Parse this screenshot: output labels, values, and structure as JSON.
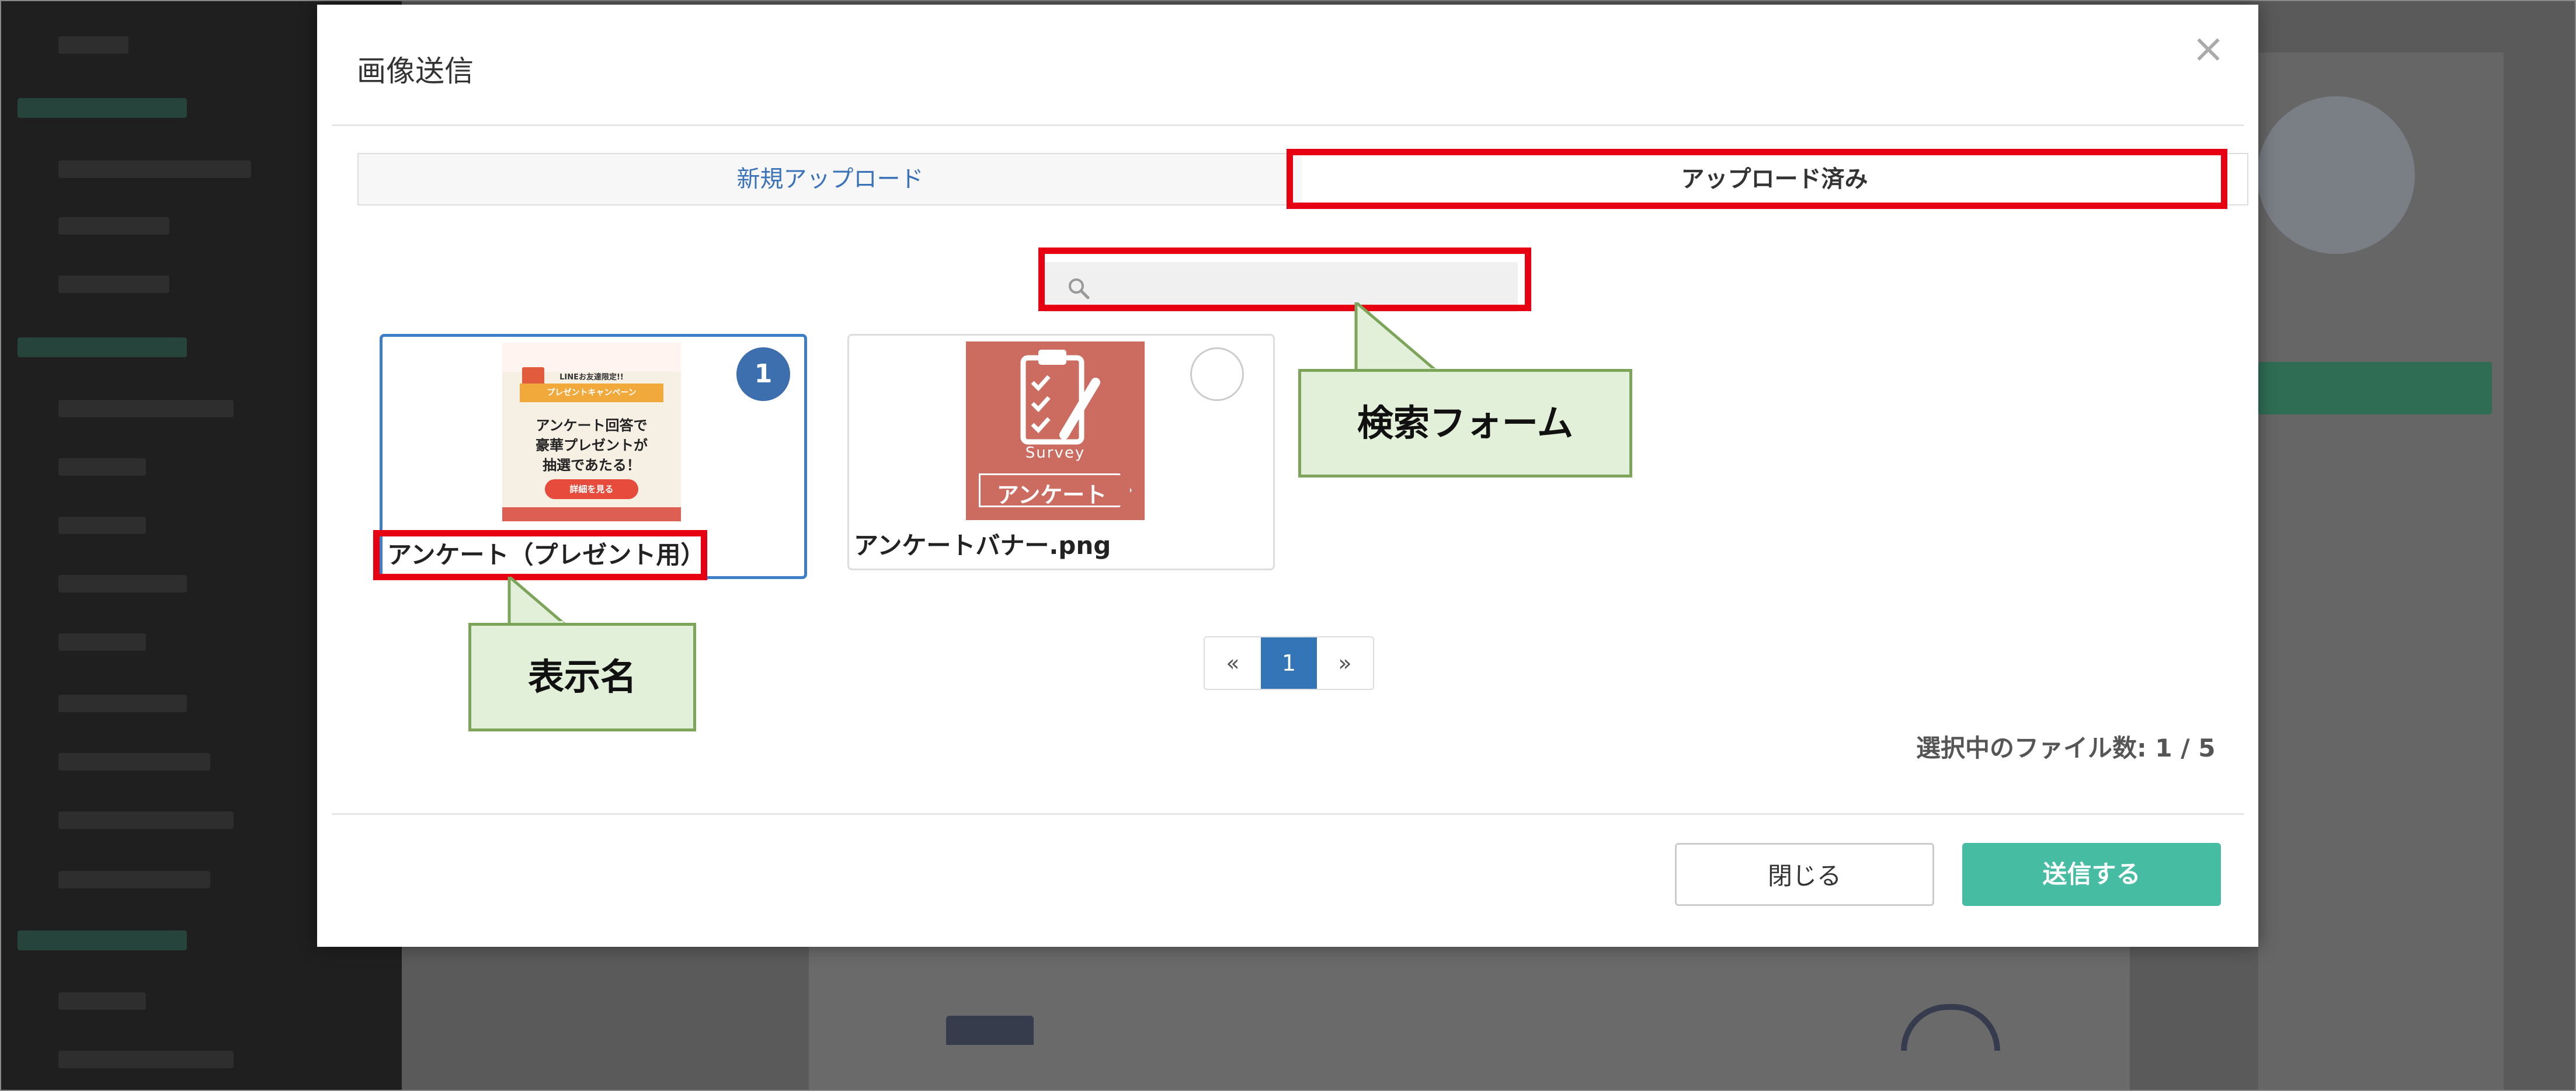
{
  "modal": {
    "title": "画像送信",
    "close_glyph": "×",
    "tabs": [
      {
        "label": "新規アップロード",
        "active": false
      },
      {
        "label": "アップロード済み",
        "active": true
      }
    ],
    "search": {
      "placeholder": "",
      "icon": "search-icon"
    },
    "images": [
      {
        "name": "アンケート（プレゼント用）",
        "selected": true,
        "order": "1",
        "thumb_text": {
          "top": "LINEお友達限定!!",
          "ribbon": "プレゼントキャンペーン",
          "line1": "アンケート回答で",
          "line2": "豪華プレゼントが",
          "line3": "抽選であたる！",
          "button": "詳細を見る"
        }
      },
      {
        "name": "アンケートバナー.png",
        "selected": false,
        "thumb_text": {
          "survey": "Survey",
          "label": "アンケート"
        }
      }
    ],
    "pagination": {
      "prev": "«",
      "current": "1",
      "next": "»"
    },
    "file_count": "選択中のファイル数: 1 / 5",
    "buttons": {
      "close": "閉じる",
      "send": "送信する"
    }
  },
  "callouts": {
    "search_form": "検索フォーム",
    "display_name": "表示名"
  },
  "colors": {
    "annotation_red": "#e60012",
    "callout_fill": "#e2efd9",
    "callout_border": "#7da55a",
    "send_button": "#46bca2",
    "selected_border": "#3d7ec6",
    "tab_link": "#3b73b9"
  }
}
